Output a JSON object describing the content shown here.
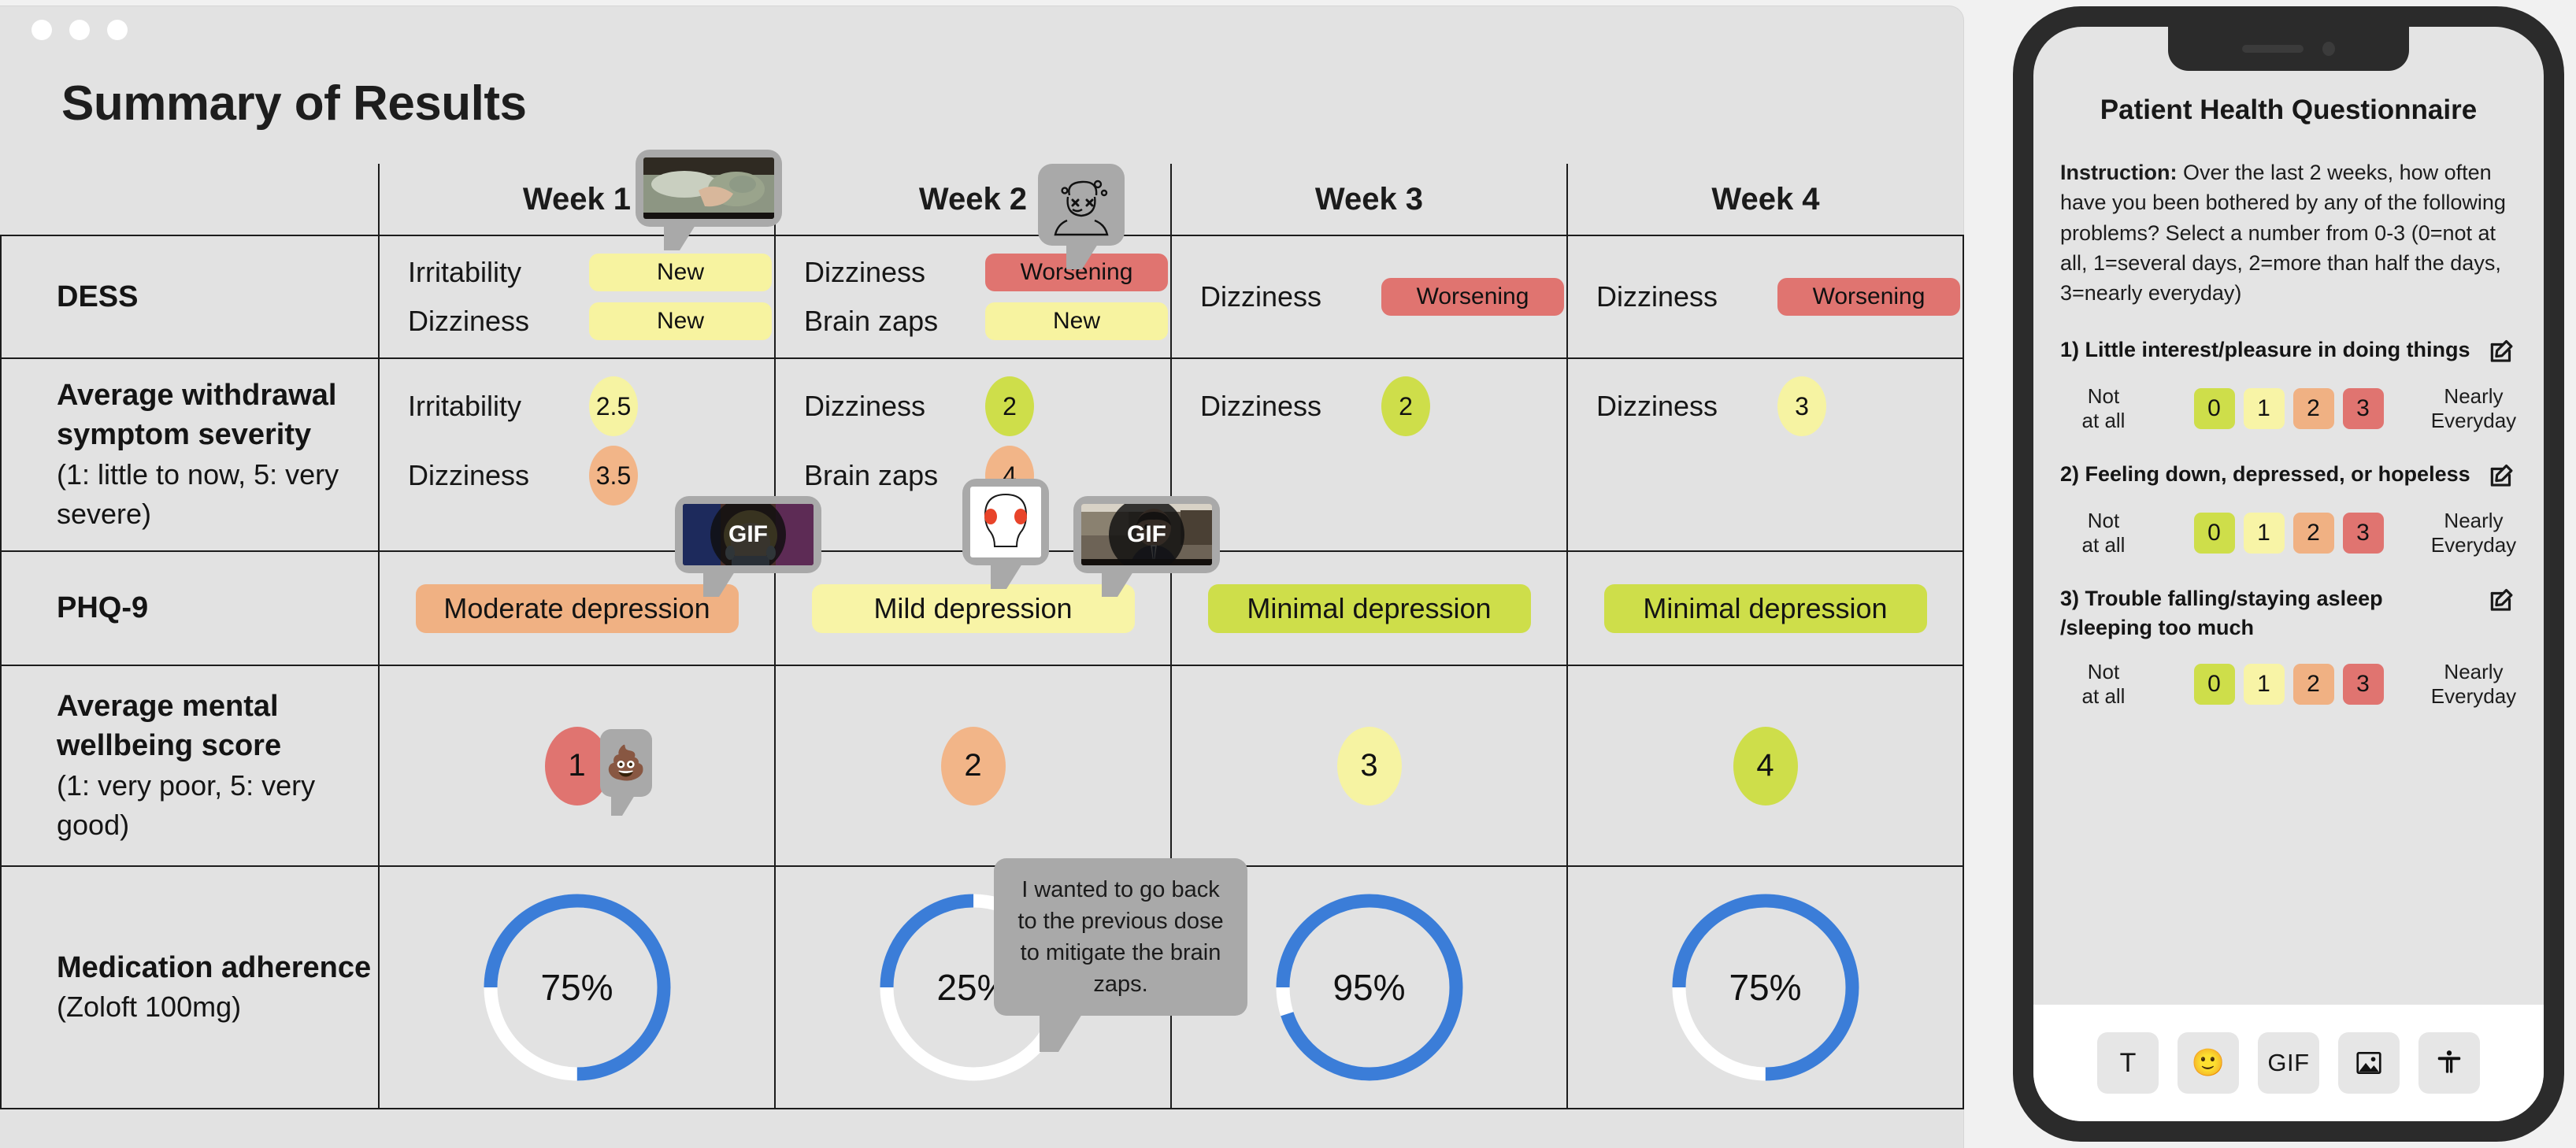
{
  "window": {
    "title": "Summary of Results",
    "traffic_lights": [
      "close",
      "minimize",
      "maximize"
    ]
  },
  "table": {
    "corner_label": "",
    "week_headers": [
      "Week 1",
      "Week 2",
      "Week 3",
      "Week 4"
    ],
    "rows": [
      {
        "id": "dess",
        "label": "DESS",
        "sublabel": "",
        "cells": [
          {
            "items": [
              {
                "name": "Irritability",
                "status": "New",
                "tone": "new"
              },
              {
                "name": "Dizziness",
                "status": "New",
                "tone": "new"
              }
            ]
          },
          {
            "items": [
              {
                "name": "Dizziness",
                "status": "Worsening",
                "tone": "worsening"
              },
              {
                "name": "Brain zaps",
                "status": "New",
                "tone": "new"
              }
            ]
          },
          {
            "items": [
              {
                "name": "Dizziness",
                "status": "Worsening",
                "tone": "worsening"
              }
            ]
          },
          {
            "items": [
              {
                "name": "Dizziness",
                "status": "Worsening",
                "tone": "worsening"
              }
            ]
          }
        ]
      },
      {
        "id": "withdrawal-severity",
        "label": "Average withdrawal symptom severity",
        "sublabel": "(1: little to now, 5: very severe)",
        "cells": [
          {
            "items": [
              {
                "name": "Irritability",
                "value": "2.5",
                "tone": "yellow"
              },
              {
                "name": "Dizziness",
                "value": "3.5",
                "tone": "orange"
              }
            ]
          },
          {
            "items": [
              {
                "name": "Dizziness",
                "value": "2",
                "tone": "green"
              },
              {
                "name": "Brain zaps",
                "value": "4",
                "tone": "orange"
              }
            ]
          },
          {
            "items": [
              {
                "name": "Dizziness",
                "value": "2",
                "tone": "green"
              }
            ]
          },
          {
            "items": [
              {
                "name": "Dizziness",
                "value": "3",
                "tone": "yellow"
              }
            ]
          }
        ]
      },
      {
        "id": "phq9",
        "label": "PHQ-9",
        "sublabel": "",
        "cells": [
          {
            "pill": {
              "text": "Moderate depression",
              "tone": "moderate"
            }
          },
          {
            "pill": {
              "text": "Mild depression",
              "tone": "mild"
            }
          },
          {
            "pill": {
              "text": "Minimal depression",
              "tone": "minimal"
            }
          },
          {
            "pill": {
              "text": "Minimal depression",
              "tone": "minimal"
            }
          }
        ]
      },
      {
        "id": "mental-wellbeing",
        "label": "Average mental wellbeing score",
        "sublabel": "(1: very poor, 5: very good)",
        "cells": [
          {
            "score": {
              "value": "1",
              "tone": "red"
            }
          },
          {
            "score": {
              "value": "2",
              "tone": "orange"
            }
          },
          {
            "score": {
              "value": "3",
              "tone": "yellow"
            }
          },
          {
            "score": {
              "value": "4",
              "tone": "green"
            }
          }
        ]
      },
      {
        "id": "medication-adherence",
        "label": "Medication adherence",
        "sublabel": "(Zoloft 100mg)",
        "cells": [
          {
            "donut": {
              "label": "75%",
              "percent": 75
            }
          },
          {
            "donut": {
              "label": "25%",
              "percent": 25
            }
          },
          {
            "donut": {
              "label": "95%",
              "percent": 95
            }
          },
          {
            "donut": {
              "label": "75%",
              "percent": 75
            }
          }
        ]
      }
    ]
  },
  "annotations": {
    "bubble_week1_photo": {
      "kind": "photo",
      "caption": "person lying in bed"
    },
    "bubble_week2_icon": {
      "kind": "illustration",
      "caption": "dizzy face with swirls"
    },
    "bubble_week1_gif": {
      "kind": "gif",
      "badge": "GIF",
      "caption": "crying cartoon character"
    },
    "bubble_week2_head": {
      "kind": "illustration",
      "caption": "head with red temple zaps"
    },
    "bubble_week2_gif": {
      "kind": "gif",
      "badge": "GIF",
      "caption": "man at desk looking blank"
    },
    "bubble_week1_emoji": {
      "kind": "emoji",
      "glyph": "💩"
    },
    "bubble_week2_text": {
      "kind": "text",
      "text": "I wanted to go back to the previous dose to mitigate the brain zaps."
    }
  },
  "phone": {
    "title": "Patient Health Questionnaire",
    "instruction_label": "Instruction:",
    "instruction_body": " Over the last 2 weeks, how often have you been bothered by any of the following problems? Select a number from 0-3 (0=not at all, 1=several days, 2=more than half the days, 3=nearly everyday)",
    "questions": [
      {
        "text": "1) Little interest/pleasure in doing things"
      },
      {
        "text": "2) Feeling down, depressed, or hopeless"
      },
      {
        "text": "3) Trouble falling/staying asleep /sleeping too much"
      }
    ],
    "scale": {
      "left_label_line1": "Not",
      "left_label_line2": "at all",
      "right_label_line1": "Nearly",
      "right_label_line2": "Everyday",
      "options": [
        "0",
        "1",
        "2",
        "3"
      ]
    },
    "toolbar": [
      {
        "name": "text-tool",
        "label": "T"
      },
      {
        "name": "emoji-tool",
        "label": "🙂"
      },
      {
        "name": "gif-tool",
        "label": "GIF"
      },
      {
        "name": "image-tool",
        "label": "image-icon"
      },
      {
        "name": "accessibility-tool",
        "label": "accessibility-icon"
      }
    ]
  },
  "colors": {
    "new": "#f7f3a0",
    "worsening": "#e07470",
    "moderate": "#f0b183",
    "mild": "#f8f4a6",
    "minimal": "#cede4a",
    "donut_fill": "#3b7dd8",
    "donut_track": "#ffffff"
  }
}
